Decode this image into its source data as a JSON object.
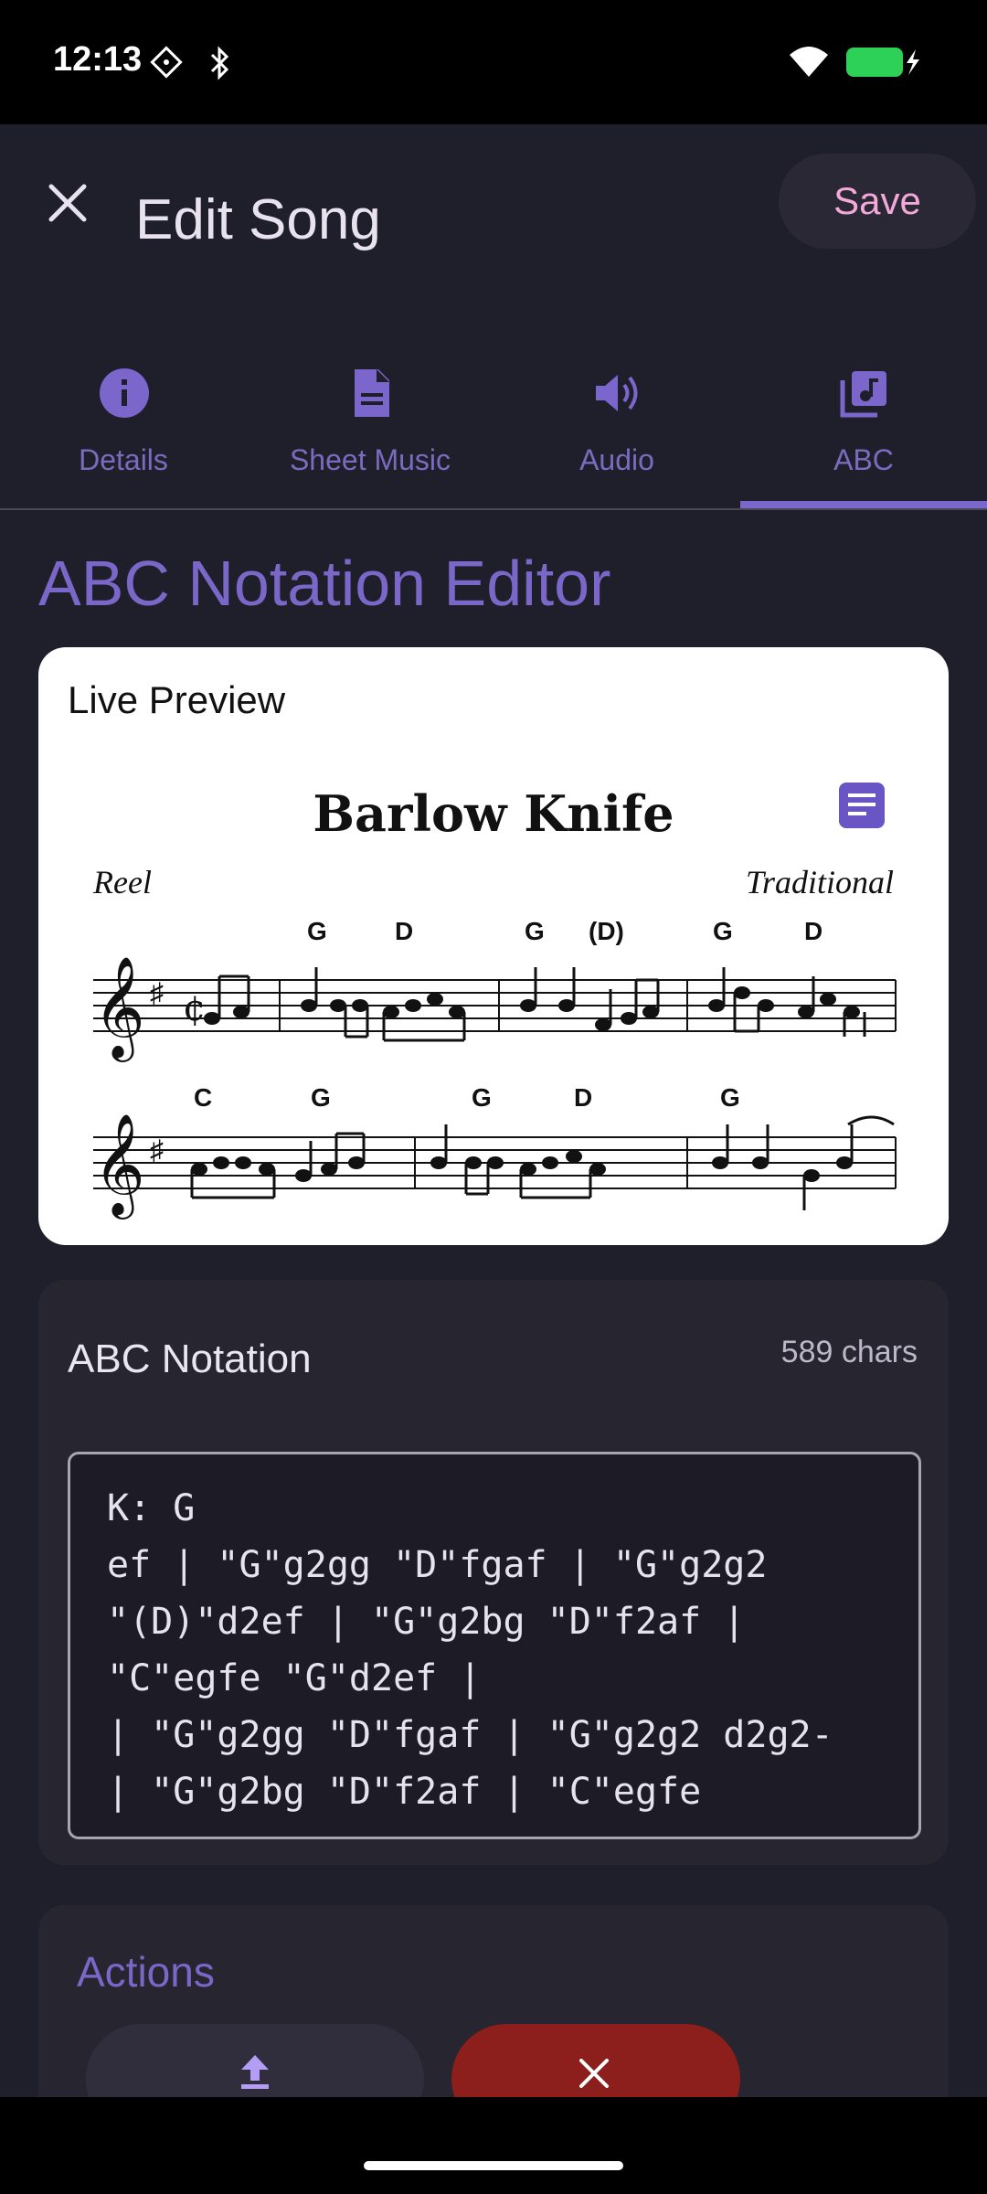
{
  "status_bar": {
    "time": "12:13",
    "icons": [
      "screen-icon",
      "bluetooth-icon",
      "wifi-icon",
      "battery-charging-icon"
    ],
    "battery_color": "#2ed158"
  },
  "header": {
    "title": "Edit Song",
    "save_label": "Save"
  },
  "tabs": [
    {
      "label": "Details",
      "icon": "info-icon"
    },
    {
      "label": "Sheet Music",
      "icon": "document-icon"
    },
    {
      "label": "Audio",
      "icon": "speaker-icon"
    },
    {
      "label": "ABC",
      "icon": "music-library-icon",
      "selected": true
    }
  ],
  "editor_title": "ABC Notation Editor",
  "preview": {
    "label": "Live Preview",
    "song_title": "Barlow Knife",
    "rhythm": "Reel",
    "composer": "Traditional",
    "line1_chords": [
      "G",
      "D",
      "G",
      "(D)",
      "G",
      "D"
    ],
    "line2_chords": [
      "C",
      "G",
      "G",
      "D",
      "G"
    ]
  },
  "abc": {
    "label": "ABC Notation",
    "char_count": "589 chars",
    "text": "K: G\nef | \"G\"g2gg \"D\"fgaf | \"G\"g2g2\n\"(D)\"d2ef | \"G\"g2bg \"D\"f2af |\n\"C\"egfe \"G\"d2ef |\n| \"G\"g2gg \"D\"fgaf | \"G\"g2g2 d2g2-\n| \"G\"g2bg \"D\"f2af | \"C\"egfe"
  },
  "actions": {
    "title": "Actions",
    "buttons": [
      {
        "icon": "upload-icon"
      },
      {
        "icon": "close-icon"
      }
    ]
  },
  "colors": {
    "accent": "#7a67c8",
    "save_text": "#f2a8d8",
    "delete": "#8c1e1c",
    "background": "#1f1f2b"
  }
}
